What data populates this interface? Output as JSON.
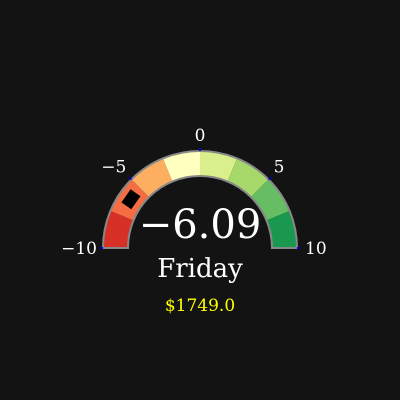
{
  "gauge": {
    "min": -10,
    "max": 10,
    "value": -6.09,
    "value_text": "−6.09",
    "tick_labels": [
      {
        "value": -10,
        "text": "−10"
      },
      {
        "value": -5,
        "text": "−5"
      },
      {
        "value": 0,
        "text": "0"
      },
      {
        "value": 5,
        "text": "5"
      },
      {
        "value": 10,
        "text": "10"
      }
    ],
    "bands": [
      {
        "from": -10,
        "to": -7.5,
        "color": "#d73027"
      },
      {
        "from": -7.5,
        "to": -5,
        "color": "#f46d43"
      },
      {
        "from": -5,
        "to": -2.5,
        "color": "#fdae61"
      },
      {
        "from": -2.5,
        "to": 0,
        "color": "#ffffbf"
      },
      {
        "from": 0,
        "to": 2.5,
        "color": "#d9ef8b"
      },
      {
        "from": 2.5,
        "to": 5,
        "color": "#a6d96a"
      },
      {
        "from": 5,
        "to": 7.5,
        "color": "#66bd63"
      },
      {
        "from": 7.5,
        "to": 10,
        "color": "#1a9850"
      }
    ],
    "pointer_color": "#000000",
    "outline_color": "#888888",
    "tick_color": "#0000cc"
  },
  "label": {
    "day": "Friday",
    "amount": "$1749.0",
    "amount_color": "#ffff00"
  }
}
